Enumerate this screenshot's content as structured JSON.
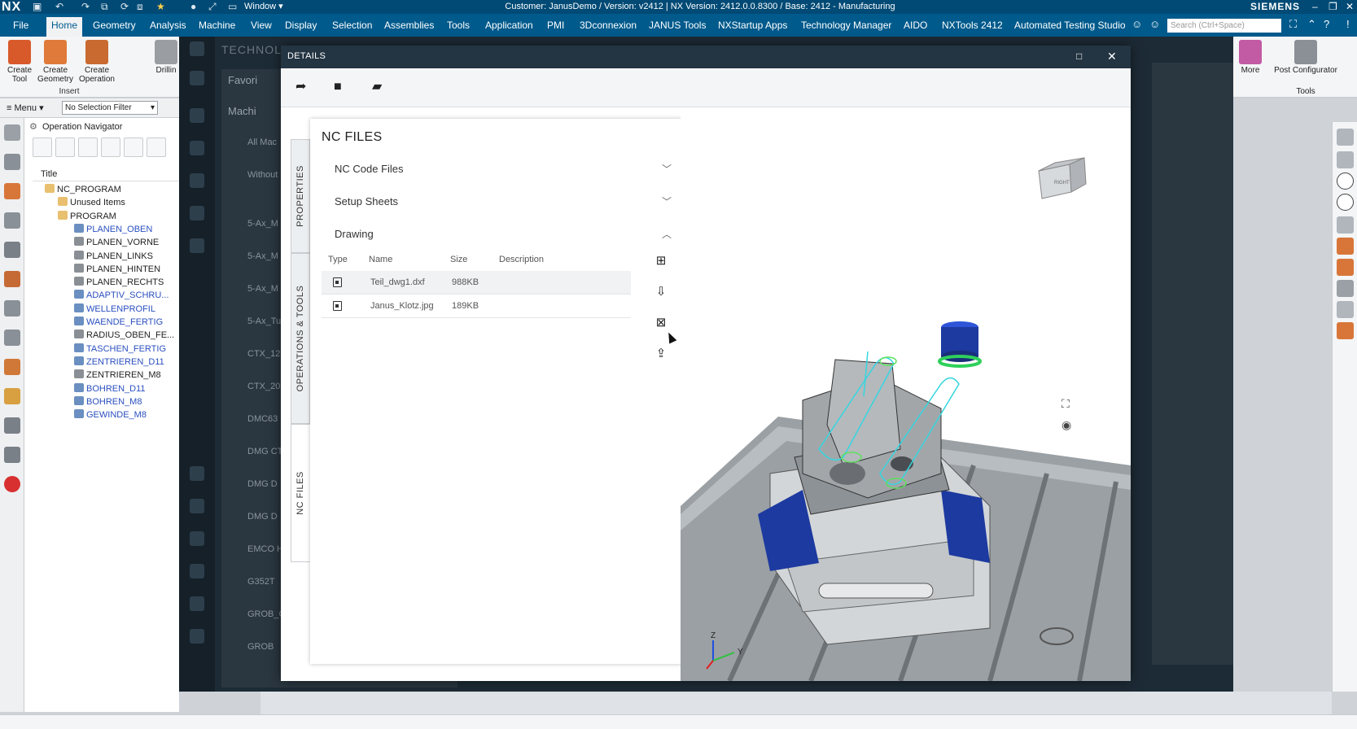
{
  "titlebar": {
    "app": "NX",
    "window_menu": "Window",
    "title": "Customer: JanusDemo / Version: v2412 | NX Version: 2412.0.0.8300 / Base: 2412 - Manufacturing",
    "brand": "SIEMENS"
  },
  "menubar": {
    "tabs": [
      "File",
      "Home",
      "Geometry",
      "Analysis",
      "Machine",
      "View",
      "Display",
      "Selection",
      "Assemblies",
      "Tools",
      "Application",
      "PMI",
      "3Dconnexion",
      "JANUS Tools",
      "NXStartup Apps",
      "Technology Manager",
      "AIDO",
      "NXTools 2412",
      "Automated Testing Studio"
    ],
    "active": "Home",
    "search_placeholder": "Search (Ctrl+Space)"
  },
  "ribbon": {
    "buttons": [
      "Create Tool",
      "Create Geometry",
      "Create Operation",
      "Drillin"
    ],
    "group": "Insert",
    "right_more": "More",
    "right_post": "Post Configurator",
    "right_group": "Tools"
  },
  "selbar": {
    "menu": "Menu",
    "filter": "No Selection Filter"
  },
  "navigator": {
    "title": "Operation Navigator",
    "column": "Title",
    "tree": [
      {
        "label": "NC_PROGRAM",
        "level": 0,
        "kind": "root"
      },
      {
        "label": "Unused Items",
        "level": 1,
        "kind": "folder"
      },
      {
        "label": "PROGRAM",
        "level": 1,
        "kind": "folder"
      },
      {
        "label": "PLANEN_OBEN",
        "level": 2,
        "kind": "op"
      },
      {
        "label": "PLANEN_VORNE",
        "level": 2,
        "kind": "plain"
      },
      {
        "label": "PLANEN_LINKS",
        "level": 2,
        "kind": "plain"
      },
      {
        "label": "PLANEN_HINTEN",
        "level": 2,
        "kind": "plain"
      },
      {
        "label": "PLANEN_RECHTS",
        "level": 2,
        "kind": "plain"
      },
      {
        "label": "ADAPTIV_SCHRU...",
        "level": 2,
        "kind": "op"
      },
      {
        "label": "WELLENPROFIL",
        "level": 2,
        "kind": "op"
      },
      {
        "label": "WAENDE_FERTIG",
        "level": 2,
        "kind": "op"
      },
      {
        "label": "RADIUS_OBEN_FE...",
        "level": 2,
        "kind": "plain"
      },
      {
        "label": "TASCHEN_FERTIG",
        "level": 2,
        "kind": "op"
      },
      {
        "label": "ZENTRIEREN_D11",
        "level": 2,
        "kind": "op"
      },
      {
        "label": "ZENTRIEREN_M8",
        "level": 2,
        "kind": "plain"
      },
      {
        "label": "BOHREN_D11",
        "level": 2,
        "kind": "op"
      },
      {
        "label": "BOHREN_M8",
        "level": 2,
        "kind": "op"
      },
      {
        "label": "GEWINDE_M8",
        "level": 2,
        "kind": "op"
      }
    ]
  },
  "background_app": {
    "heading": "TECHNOLOGY MANAGER",
    "favorites": "Favori",
    "machines": "Machi",
    "items": [
      "All Mac",
      "Without",
      "5-Ax_M",
      "5-Ax_M",
      "5-Ax_M",
      "5-Ax_Tu",
      "CTX_12",
      "CTX_20",
      "DMC63",
      "DMG CT",
      "DMG D",
      "DMG D",
      "EMCO H",
      "G352T",
      "GROB_G",
      "GROB"
    ]
  },
  "dialog": {
    "title": "DETAILS",
    "tabs": [
      "PROPERTIES",
      "OPERATIONS & TOOLS",
      "NC FILES"
    ],
    "active_tab": "NC FILES",
    "panel_title": "NC FILES",
    "sections": [
      {
        "label": "NC Code Files",
        "expanded": false
      },
      {
        "label": "Setup Sheets",
        "expanded": false
      },
      {
        "label": "Drawing",
        "expanded": true
      }
    ],
    "table": {
      "columns": [
        "Type",
        "Name",
        "Size",
        "Description"
      ],
      "rows": [
        {
          "name": "Teil_dwg1.dxf",
          "size": "988KB",
          "description": ""
        },
        {
          "name": "Janus_Klotz.jpg",
          "size": "189KB",
          "description": ""
        }
      ]
    },
    "viewcube_label": "RIGHT"
  },
  "colors": {
    "title_bar": "#004a75",
    "menu_bar": "#005a8c",
    "dialog_header": "#233442",
    "toolpath": "#36d6e0",
    "fixture_blue": "#1d3aa0"
  }
}
